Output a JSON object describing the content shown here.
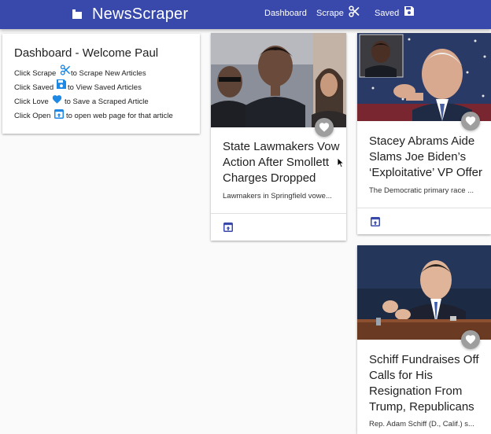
{
  "nav": {
    "brand": "NewsScraper",
    "links": {
      "dashboard": "Dashboard",
      "scrape": "Scrape",
      "saved": "Saved"
    },
    "icons": {
      "brand": "folder-icon",
      "scrape": "scissors-icon",
      "saved": "floppy-disk-icon"
    }
  },
  "welcome": {
    "title": "Dashboard - Welcome Paul",
    "lines": [
      {
        "pre": "Click Scrape",
        "post": "to Scrape New Articles",
        "icon": "scissors-icon"
      },
      {
        "pre": "Click Saved",
        "post": "to View Saved Articles",
        "icon": "floppy-disk-icon"
      },
      {
        "pre": "Click Love",
        "post": "to Save a Scraped Article",
        "icon": "heart-icon"
      },
      {
        "pre": "Click Open",
        "post": "to open web page for that article",
        "icon": "open-in-browser-icon"
      }
    ]
  },
  "articles": [
    {
      "title_lines": [
        "State Lawmakers Vow",
        "Action After Smollett",
        "Charges Dropped"
      ],
      "description": "Lawmakers in Springfield vowe..."
    },
    {
      "title_lines": [
        "Stacey Abrams Aide",
        "Slams Joe Biden’s",
        "‘Exploitative’ VP Offer"
      ],
      "description": "The Democratic primary race ..."
    },
    {
      "title_lines": [
        "Schiff Fundraises Off",
        "Calls for His",
        "Resignation From",
        "Trump, Republicans"
      ],
      "description": "Rep. Adam Schiff (D., Calif.) s..."
    }
  ],
  "colors": {
    "navbar": "#3949ab",
    "accent_blue": "#1e88e5",
    "fav_button": "#9e9e9e"
  }
}
